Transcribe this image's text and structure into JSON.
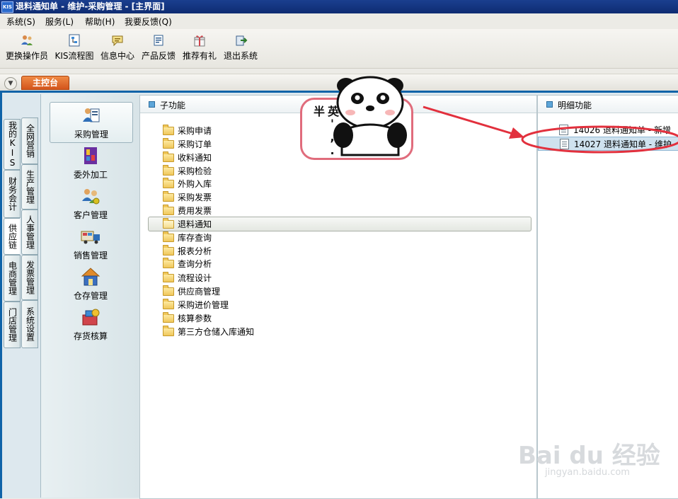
{
  "window": {
    "app_icon": "KIS",
    "title": "退料通知单 - 维护-采购管理 - [主界面]"
  },
  "menu": [
    {
      "label": "系统(S)"
    },
    {
      "label": "服务(L)"
    },
    {
      "label": "帮助(H)"
    },
    {
      "label": "我要反馈(Q)"
    }
  ],
  "toolbar": [
    {
      "label": "更换操作员",
      "icon": "change-operator-icon"
    },
    {
      "label": "KIS流程图",
      "icon": "flowchart-icon"
    },
    {
      "label": "信息中心",
      "icon": "message-center-icon"
    },
    {
      "label": "产品反馈",
      "icon": "feedback-icon"
    },
    {
      "label": "推荐有礼",
      "icon": "gift-icon"
    },
    {
      "label": "退出系统",
      "icon": "exit-icon"
    }
  ],
  "console": {
    "tab_label": "主控台",
    "toggle_icon": "chevron-down-icon"
  },
  "vertical_tabs_left": [
    {
      "label": "我的KIS"
    },
    {
      "label": "财务会计"
    },
    {
      "label": "供应链",
      "active": true
    },
    {
      "label": "电商管理"
    },
    {
      "label": "门店管理"
    }
  ],
  "vertical_tabs_right": [
    {
      "label": "全网营销"
    },
    {
      "label": "生产管理"
    },
    {
      "label": "人事管理"
    },
    {
      "label": "发票管理"
    },
    {
      "label": "系统设置"
    }
  ],
  "modules": [
    {
      "label": "采购管理",
      "icon": "purchase-management-icon",
      "active": true
    },
    {
      "label": "委外加工",
      "icon": "outsourcing-icon"
    },
    {
      "label": "客户管理",
      "icon": "customer-management-icon"
    },
    {
      "label": "销售管理",
      "icon": "sales-truck-icon"
    },
    {
      "label": "仓存管理",
      "icon": "warehouse-icon"
    },
    {
      "label": "存货核算",
      "icon": "inventory-accounting-icon"
    }
  ],
  "subfunctions": {
    "header": "子功能",
    "items": [
      {
        "label": "采购申请"
      },
      {
        "label": "采购订单"
      },
      {
        "label": "收料通知"
      },
      {
        "label": "采购检验"
      },
      {
        "label": "外购入库"
      },
      {
        "label": "采购发票"
      },
      {
        "label": "费用发票"
      },
      {
        "label": "退料通知",
        "selected": true
      },
      {
        "label": "库存查询"
      },
      {
        "label": "报表分析"
      },
      {
        "label": "查询分析"
      },
      {
        "label": "流程设计"
      },
      {
        "label": "供应商管理"
      },
      {
        "label": "采购进价管理"
      },
      {
        "label": "核算参数"
      },
      {
        "label": "第三方仓储入库通知"
      }
    ]
  },
  "details": {
    "header": "明细功能",
    "items": [
      {
        "label": "14026  退料通知单 - 新增"
      },
      {
        "label": "14027  退料通知单 - 维护",
        "selected": true
      }
    ]
  },
  "overlay": {
    "sticker_text": "英',.半",
    "annotation_color": "#e2303d",
    "watermark": "Bai du 经验",
    "watermark_url": "jingyan.baidu.com"
  }
}
